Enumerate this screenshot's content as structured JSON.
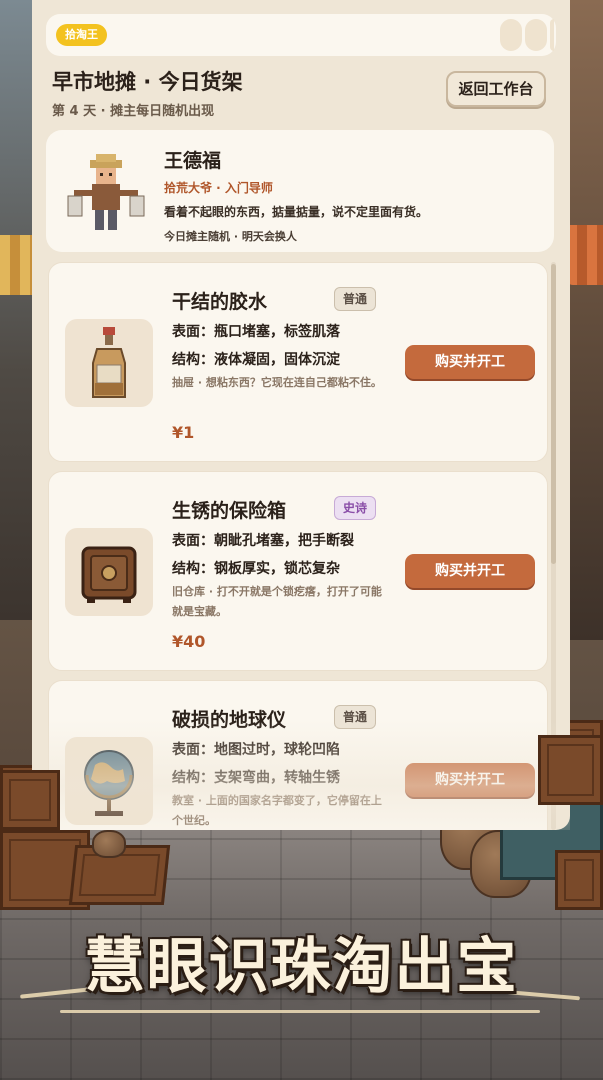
{
  "app_badge": "拾淘王",
  "header": {
    "title": "早市地摊 · 今日货架",
    "subtitle": "第 4 天 · 摊主每日随机出现",
    "back_label": "返回工作台"
  },
  "vendor": {
    "name": "王德福",
    "role": "拾荒大爷 · 入门导师",
    "description": "看着不起眼的东西，掂量掂量，说不定里面有货。",
    "note": "今日摊主随机 · 明天会换人"
  },
  "items": [
    {
      "name": "干结的胶水",
      "rarity": "普通",
      "surface": "表面：瓶口堵塞，标签肌落",
      "structure": "结构：液体凝固，固体沉淀",
      "origin": "抽屉 · 想粘东西？它现在连自己都粘不住。",
      "price": "¥1",
      "buy_label": "购买并开工",
      "icon": "glue-bottle-icon"
    },
    {
      "name": "生锈的保险箱",
      "rarity": "史诗",
      "surface": "表面：朝眦孔堵塞，把手断裂",
      "structure": "结构：钢板厚实，锁芯复杂",
      "origin": "旧仓库 · 打不开就是个锁疙瘩，打开了可能就是宝藏。",
      "price": "¥40",
      "buy_label": "购买并开工",
      "icon": "safe-icon"
    },
    {
      "name": "破损的地球仪",
      "rarity": "普通",
      "surface": "表面：地图过时，球轮凹陷",
      "structure": "结构：支架弯曲，转轴生锈",
      "origin": "教室 · 上面的国家名字都变了，它停留在上个世纪。",
      "price": "",
      "buy_label": "购买并开工",
      "icon": "globe-icon"
    }
  ],
  "slogan": "慧眼识珠淘出宝",
  "colors": {
    "accent": "#c46a3d",
    "badge": "#f3c21f",
    "epic": "#8a4ea8",
    "price": "#b0562a"
  }
}
